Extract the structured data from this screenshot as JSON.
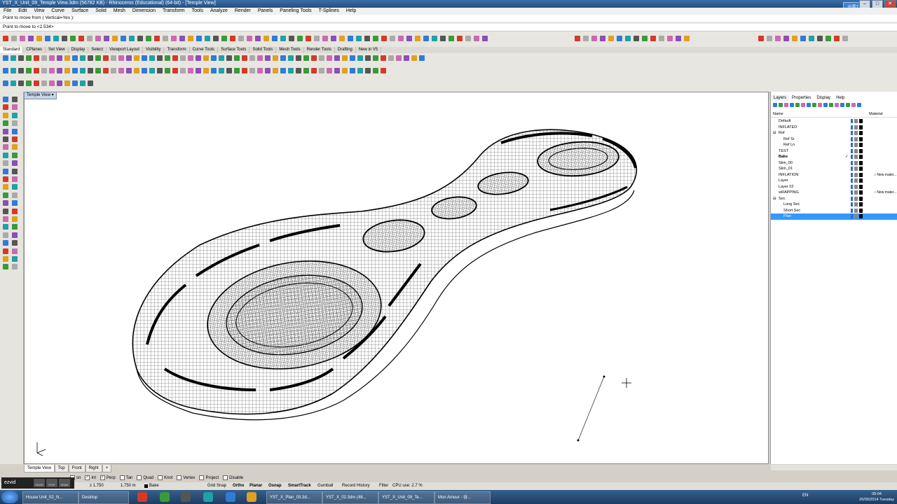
{
  "window": {
    "title": "YST_X_Unit_09_Temple View.3dm (56782 KB) - Rhinoceros (Educational) (64-bit) - [Temple View]",
    "ime": "迅雷7"
  },
  "menu": [
    "File",
    "Edit",
    "View",
    "Curve",
    "Surface",
    "Solid",
    "Mesh",
    "Dimension",
    "Transform",
    "Tools",
    "Analyze",
    "Render",
    "Panels",
    "Paneling Tools",
    "T-Splines",
    "Help"
  ],
  "command": {
    "history": "Point to move from ( Vertical=Yes ):",
    "prompt": "Point to move to <2.534>"
  },
  "toolbar_tabs": [
    "Standard",
    "CPlanes",
    "Set View",
    "Display",
    "Select",
    "Viewport Layout",
    "Visibility",
    "Transform",
    "Curve Tools",
    "Surface Tools",
    "Solid Tools",
    "Mesh Tools",
    "Render Tools",
    "Drafting",
    "New in V5"
  ],
  "viewport": {
    "title": "Temple View"
  },
  "panel": {
    "tabs": [
      "Layers",
      "Properties",
      "Display",
      "Help"
    ],
    "columns": {
      "name": "Name",
      "material": "Material"
    },
    "layers": [
      {
        "name": "Default",
        "indent": 0
      },
      {
        "name": "INFLATED",
        "indent": 0
      },
      {
        "name": "Ref",
        "indent": 0,
        "expander": "⊟"
      },
      {
        "name": "Ref Sr",
        "indent": 1
      },
      {
        "name": "Ref Ln",
        "indent": 1
      },
      {
        "name": "TEST",
        "indent": 0
      },
      {
        "name": "Bake",
        "indent": 0,
        "bold": true,
        "check": "✓"
      },
      {
        "name": "Skin_00",
        "indent": 0
      },
      {
        "name": "Skin_01",
        "indent": 0
      },
      {
        "name": "INFLATION",
        "indent": 0,
        "material": "New mater..."
      },
      {
        "name": "Layer",
        "indent": 0
      },
      {
        "name": "Layer 02",
        "indent": 0
      },
      {
        "name": "wRAPPING",
        "indent": 0,
        "material": "New mater..."
      },
      {
        "name": "Sec",
        "indent": 0,
        "expander": "⊟"
      },
      {
        "name": "Long Sec",
        "indent": 1
      },
      {
        "name": "Short Sec",
        "indent": 1
      },
      {
        "name": "Plan",
        "indent": 1,
        "selected": true
      }
    ]
  },
  "view_tabs": [
    "Temple View",
    "Top",
    "Front",
    "Right",
    "+"
  ],
  "osnap": [
    {
      "label": "sn",
      "checked": false
    },
    {
      "label": "Int",
      "checked": true
    },
    {
      "label": "Perp",
      "checked": true
    },
    {
      "label": "Tan",
      "checked": false
    },
    {
      "label": "Quad",
      "checked": false
    },
    {
      "label": "Knot",
      "checked": false
    },
    {
      "label": "Vertex",
      "checked": false
    },
    {
      "label": "Project",
      "checked": false
    },
    {
      "label": "Disable",
      "checked": false
    }
  ],
  "status": {
    "coord": "z 1.750",
    "dist": "1.750 m",
    "layer": "Bake",
    "grid_snap": "Grid Snap",
    "ortho": "Ortho",
    "planar": "Planar",
    "osnap": "Osnap",
    "smarttrack": "SmartTrack",
    "gumball": "Gumball",
    "record_history": "Record History",
    "filter": "Filter",
    "cpu": "CPU use: 2.7 %"
  },
  "recorder": {
    "logo": "ezvid",
    "buttons": [
      "PAUSE",
      "STOP",
      "DRAW"
    ]
  },
  "taskbar": {
    "items": [
      "House Unit_02_N...",
      "Desktop",
      "YST_X_Plan_03.3d...",
      "YST_X_02.3dm (48...",
      "YST_X_Unit_09_Te...",
      "Mon Amour - 谷..."
    ],
    "lang": "EN",
    "time": "05:04",
    "date": "20/05/2014 Tuesday"
  },
  "colors": {
    "selection": "#3399ff",
    "titlebar": "#2b5a91",
    "taskbar": "#27486f"
  }
}
